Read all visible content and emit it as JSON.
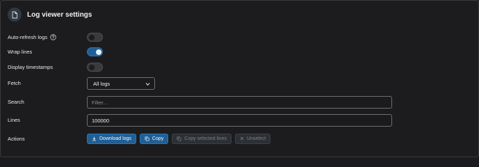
{
  "header": {
    "title": "Log viewer settings",
    "icon": "document-icon"
  },
  "settings": {
    "auto_refresh": {
      "label": "Auto-refresh logs",
      "on": false
    },
    "wrap_lines": {
      "label": "Wrap lines",
      "on": true
    },
    "display_timestamps": {
      "label": "Display timestamps",
      "on": false
    },
    "fetch": {
      "label": "Fetch",
      "value": "All logs"
    },
    "search": {
      "label": "Search",
      "placeholder": "Filter..."
    },
    "lines": {
      "label": "Lines",
      "value": "100000"
    },
    "actions": {
      "label": "Actions",
      "download_label": "Download logs",
      "copy_label": "Copy",
      "copy_selected_label": "Copy selected lines",
      "unselect_label": "Unselect"
    }
  },
  "colors": {
    "accent": "#1f5f96",
    "background": "#1c1c1e",
    "disabled": "#2c2f35"
  }
}
